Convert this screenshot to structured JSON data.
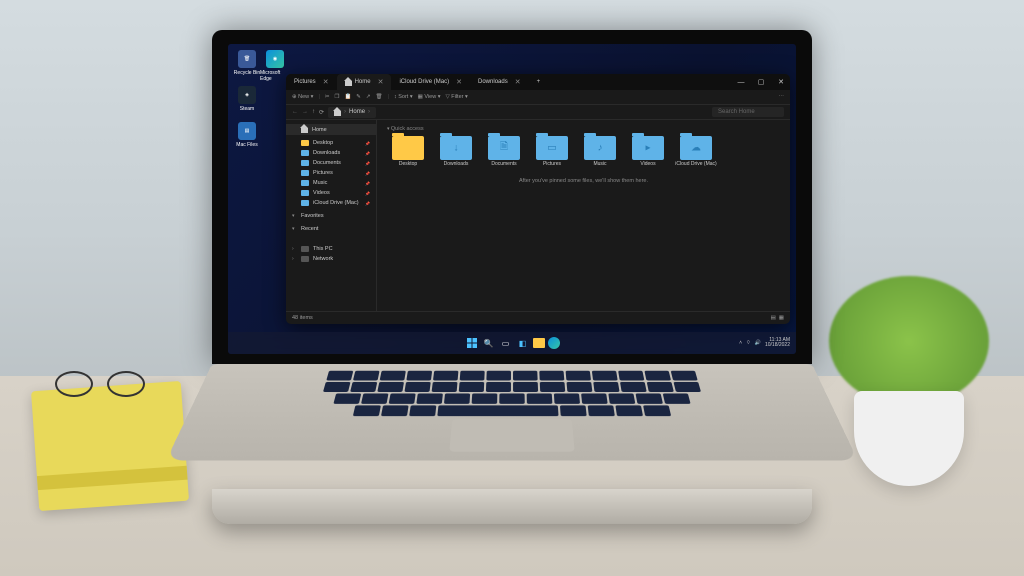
{
  "desktop_icons": [
    {
      "label": "Recycle Bin",
      "name": "recycle-bin",
      "bg": "#3a5998"
    },
    {
      "label": "Microsoft Edge",
      "name": "edge",
      "bg": "#0b8fdb"
    },
    {
      "label": "Steam",
      "name": "steam",
      "bg": "#1a2838"
    },
    {
      "label": "Mac Files",
      "name": "mac-files",
      "bg": "#2a6fb8"
    }
  ],
  "window": {
    "min": "—",
    "max": "▢",
    "close": "✕"
  },
  "tabs": [
    {
      "label": "Pictures",
      "active": false
    },
    {
      "label": "Home",
      "active": true
    },
    {
      "label": "iCloud Drive (Mac)",
      "active": false
    },
    {
      "label": "Downloads",
      "active": false
    }
  ],
  "toolbar": {
    "new": "New",
    "cut": "✂",
    "copy": "❐",
    "paste": "📋",
    "rename": "✎",
    "share": "↗",
    "delete": "🗑",
    "sort": "Sort",
    "view": "View",
    "filter": "Filter"
  },
  "address": {
    "home": "Home",
    "search": "Search Home"
  },
  "nav": {
    "home": "Home",
    "items": [
      {
        "label": "Desktop",
        "color": "yellow"
      },
      {
        "label": "Downloads",
        "color": "blue"
      },
      {
        "label": "Documents",
        "color": "blue"
      },
      {
        "label": "Pictures",
        "color": "blue"
      },
      {
        "label": "Music",
        "color": "blue"
      },
      {
        "label": "Videos",
        "color": "blue"
      },
      {
        "label": "iCloud Drive (Mac)",
        "color": "blue"
      }
    ],
    "favorites": "Favorites",
    "recent": "Recent",
    "thispc": "This PC",
    "network": "Network"
  },
  "section": "Quick access",
  "folders": [
    {
      "label": "Desktop",
      "color": "yellow",
      "glyph": ""
    },
    {
      "label": "Downloads",
      "color": "blue",
      "glyph": "↓"
    },
    {
      "label": "Documents",
      "color": "blue",
      "glyph": "🗎"
    },
    {
      "label": "Pictures",
      "color": "blue",
      "glyph": "▭"
    },
    {
      "label": "Music",
      "color": "blue",
      "glyph": "♪"
    },
    {
      "label": "Videos",
      "color": "blue",
      "glyph": "▸"
    },
    {
      "label": "iCloud Drive (Mac)",
      "color": "blue",
      "glyph": "☁"
    }
  ],
  "empty_msg": "After you've pinned some files, we'll show them here.",
  "status": "48 items",
  "tray": {
    "time": "11:13 AM",
    "date": "10/18/2022"
  }
}
